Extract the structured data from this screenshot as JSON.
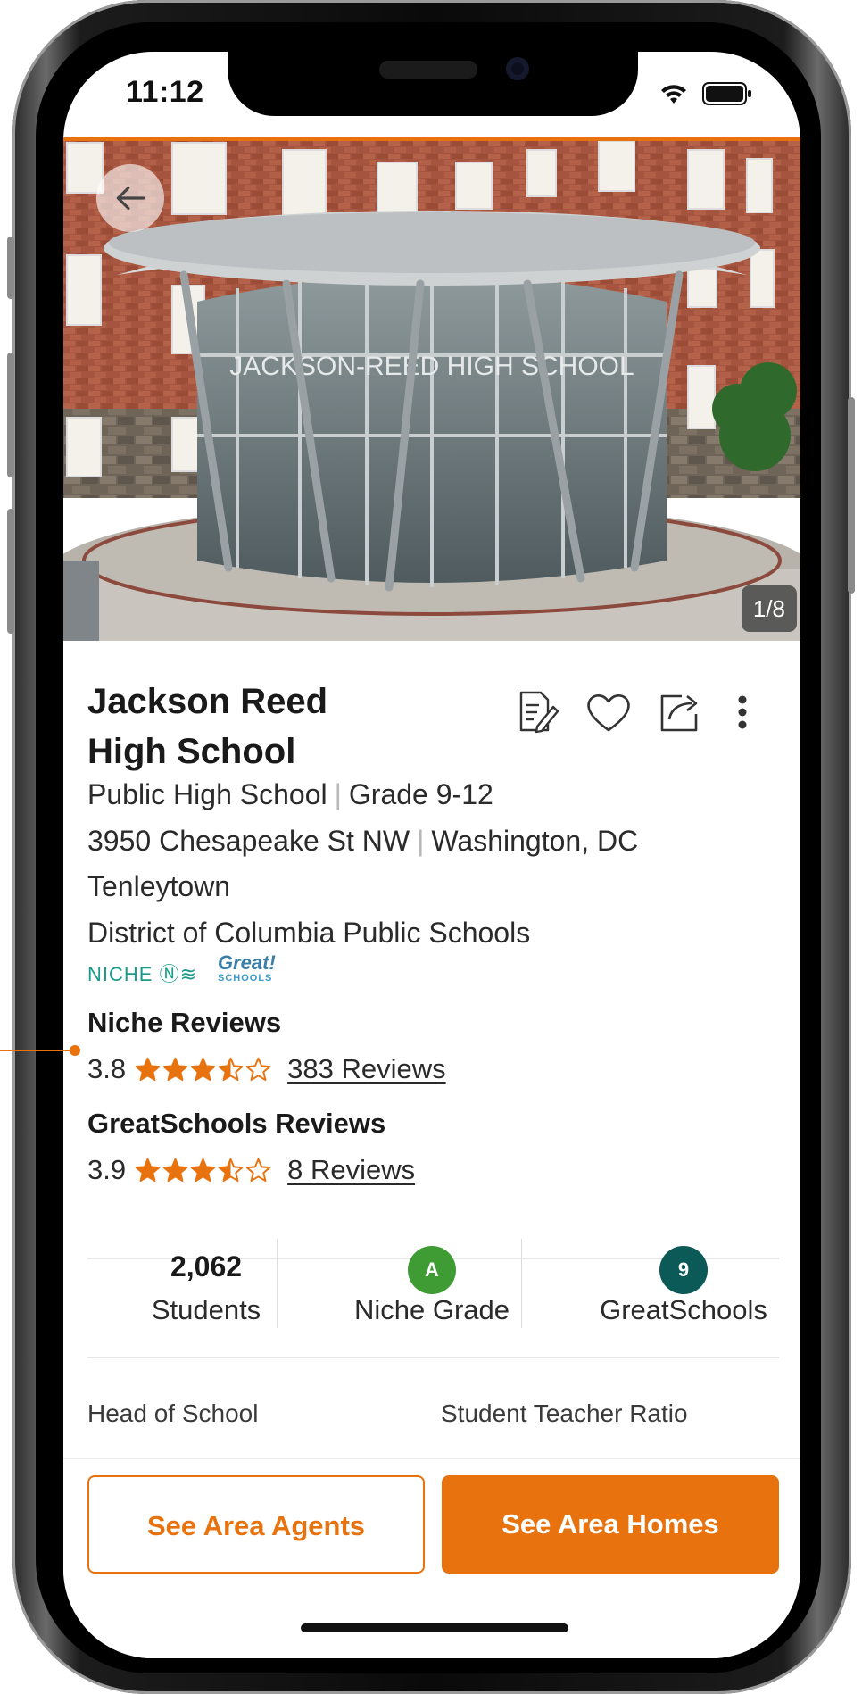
{
  "status_bar": {
    "time": "11:12"
  },
  "hero": {
    "photo_counter": "1/8",
    "sign_text": "JACKSON-REED HIGH SCHOOL"
  },
  "school": {
    "name_line1": "Jackson Reed",
    "name_line2": "High School",
    "type": "Public High School",
    "grades": "Grade 9-12",
    "street": "3950 Chesapeake St NW",
    "city": "Washington, DC",
    "neighborhood": "Tenleytown",
    "district": "District of Columbia Public Schools"
  },
  "logos": {
    "niche": "NICHE",
    "greatschools_top": "Great!",
    "greatschools_bottom": "SCHOOLS"
  },
  "niche_reviews": {
    "title": "Niche Reviews",
    "rating": "3.8",
    "stars": 3.5,
    "link": "383 Reviews"
  },
  "greatschools_reviews": {
    "title": "GreatSchools Reviews",
    "rating": "3.9",
    "stars": 3.5,
    "link": "8 Reviews"
  },
  "stats": {
    "students_value": "2,062",
    "students_label": "Students",
    "niche_grade_value": "A",
    "niche_grade_label": "Niche Grade",
    "greatschools_value": "9",
    "greatschools_label": "GreatSchools"
  },
  "fields": {
    "head_of_school": "Head of School",
    "student_teacher_ratio": "Student Teacher Ratio"
  },
  "buttons": {
    "agents": "See Area Agents",
    "homes": "See Area Homes"
  },
  "colors": {
    "accent": "#e8720e",
    "niche_green": "#3f9b33",
    "greatschools_teal": "#0c5a57",
    "star": "#e8720e"
  },
  "icons": [
    "back-arrow-icon",
    "notes-icon",
    "heart-icon",
    "share-icon",
    "more-vertical-icon",
    "wifi-icon",
    "battery-icon",
    "star-icon"
  ]
}
